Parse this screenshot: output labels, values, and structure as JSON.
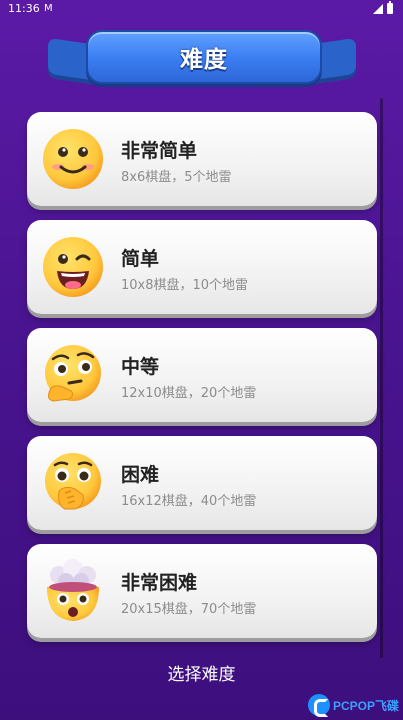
{
  "status_bar": {
    "time": "11:36",
    "mail_glyph": "M"
  },
  "header": {
    "title": "难度"
  },
  "levels": [
    {
      "name": "非常简单",
      "desc": "8x6棋盘，5个地雷",
      "icon": "smiling-face-icon"
    },
    {
      "name": "简单",
      "desc": "10x8棋盘，10个地雷",
      "icon": "winking-face-icon"
    },
    {
      "name": "中等",
      "desc": "12x10棋盘，20个地雷",
      "icon": "thinking-face-icon"
    },
    {
      "name": "困难",
      "desc": "16x12棋盘，40个地雷",
      "icon": "face-with-hand-over-mouth-icon"
    },
    {
      "name": "非常困难",
      "desc": "20x15棋盘，70个地雷",
      "icon": "exploding-head-icon"
    }
  ],
  "footer": {
    "label": "选择难度"
  },
  "watermark": {
    "text": "PCPOP飞碟"
  },
  "colors": {
    "background": "#4a1491",
    "banner": "#3a7df0",
    "emoji": "#ffc83d"
  }
}
